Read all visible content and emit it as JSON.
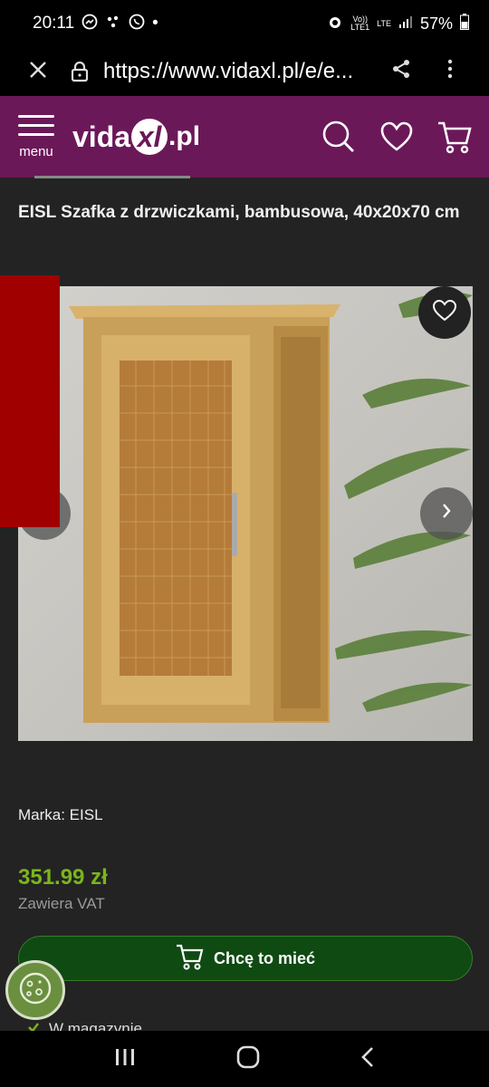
{
  "status_bar": {
    "time": "20:11",
    "battery": "57%",
    "dot": "•",
    "volte": "Vo))",
    "lte": "LTE",
    "lte1": "LTE1"
  },
  "browser": {
    "url": "https://www.vidaxl.pl/e/e..."
  },
  "header": {
    "menu_label": "menu",
    "logo_prefix": "vida",
    "logo_mark": "xl",
    "logo_suffix": ".pl"
  },
  "product": {
    "title": "EISL Szafka z drzwiczkami, bambusowa, 40x20x70 cm",
    "brand": "Marka: EISL",
    "price": "351.99 zł",
    "vat": "Zawiera VAT",
    "buy_label": "Chcę to mieć",
    "stock_label": "W magazynie"
  },
  "colors": {
    "header_bg": "#6b1859",
    "price": "#7ab51d",
    "buy_bg": "#0f4a12",
    "red_tab": "#a00000"
  }
}
